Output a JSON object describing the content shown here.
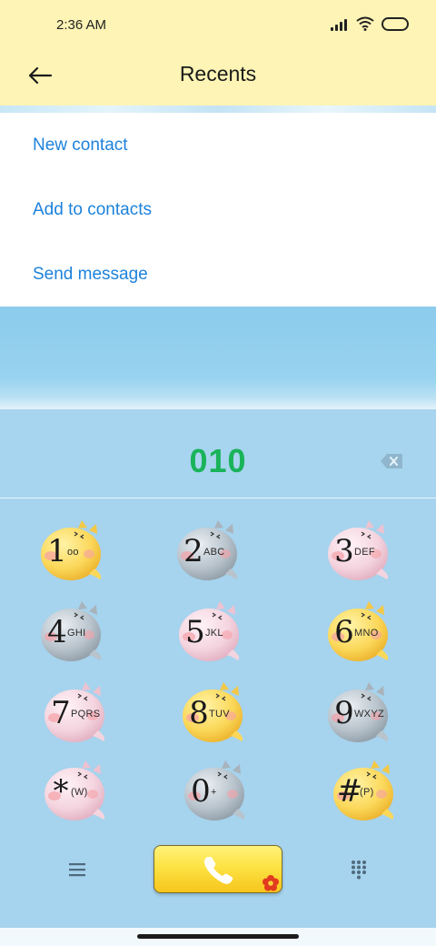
{
  "status": {
    "time": "2:36 AM",
    "icons": [
      "signal-icon",
      "wifi-icon",
      "battery-icon"
    ]
  },
  "header": {
    "title": "Recents",
    "back_icon": "arrow-left-icon"
  },
  "menu": {
    "items": [
      {
        "id": "new-contact",
        "label": "New contact"
      },
      {
        "id": "add-to-contacts",
        "label": "Add to contacts"
      },
      {
        "id": "send-message",
        "label": "Send message"
      }
    ]
  },
  "dialer": {
    "number": "010",
    "delete_icon": "backspace-icon",
    "keys": [
      {
        "digit": "1",
        "letters": "oo",
        "color": "yellow"
      },
      {
        "digit": "2",
        "letters": "ABC",
        "color": "grey"
      },
      {
        "digit": "3",
        "letters": "DEF",
        "color": "pink"
      },
      {
        "digit": "4",
        "letters": "GHI",
        "color": "grey"
      },
      {
        "digit": "5",
        "letters": "JKL",
        "color": "pink"
      },
      {
        "digit": "6",
        "letters": "MNO",
        "color": "yellow"
      },
      {
        "digit": "7",
        "letters": "PQRS",
        "color": "pink"
      },
      {
        "digit": "8",
        "letters": "TUV",
        "color": "yellow"
      },
      {
        "digit": "9",
        "letters": "WXYZ",
        "color": "grey"
      },
      {
        "digit": "*",
        "letters": "(W)",
        "color": "pink"
      },
      {
        "digit": "0",
        "letters": "+",
        "color": "grey"
      },
      {
        "digit": "#",
        "letters": "(P)",
        "color": "yellow"
      }
    ]
  },
  "bottom": {
    "menu_icon": "hamburger-icon",
    "call_icon": "phone-icon",
    "dialpad_icon": "dialpad-icon"
  },
  "colors": {
    "header_bg": "#fdf4b5",
    "link": "#1d82db",
    "number": "#19b35a",
    "keypad_bg": "#a6d3ed"
  }
}
